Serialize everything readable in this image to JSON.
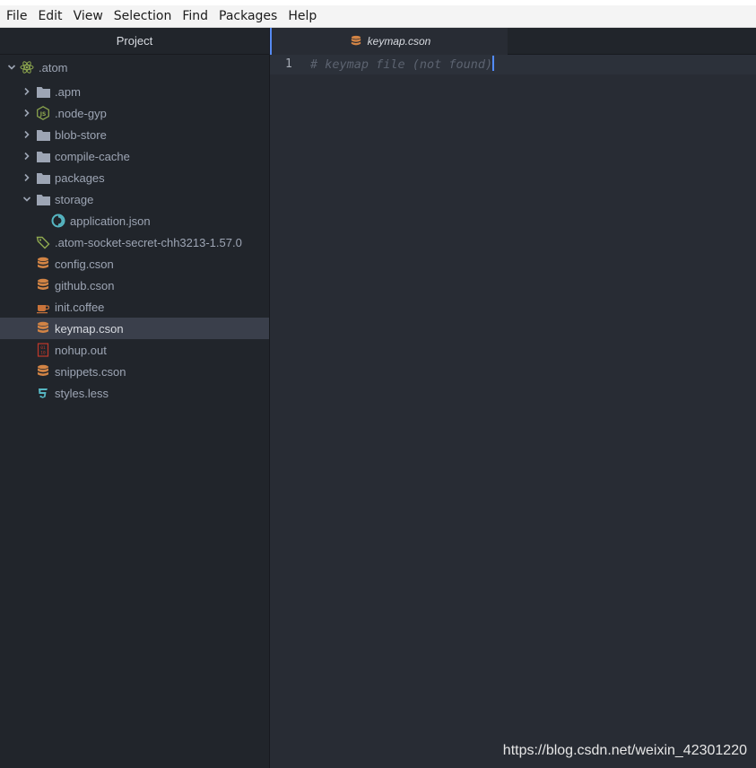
{
  "menubar": {
    "items": [
      "File",
      "Edit",
      "View",
      "Selection",
      "Find",
      "Packages",
      "Help"
    ]
  },
  "tree_view": {
    "header": "Project",
    "root": ".atom",
    "items": [
      {
        "label": ".apm",
        "icon": "folder-icon",
        "expanded": false
      },
      {
        "label": ".node-gyp",
        "icon": "nodejs-icon",
        "expanded": false
      },
      {
        "label": "blob-store",
        "icon": "folder-icon",
        "expanded": false
      },
      {
        "label": "compile-cache",
        "icon": "folder-icon",
        "expanded": false
      },
      {
        "label": "packages",
        "icon": "folder-icon",
        "expanded": false
      },
      {
        "label": "storage",
        "icon": "folder-icon",
        "expanded": true
      },
      {
        "label": "application.json",
        "icon": "json-icon"
      },
      {
        "label": ".atom-socket-secret-chh3213-1.57.0",
        "icon": "tag-icon"
      },
      {
        "label": "config.cson",
        "icon": "database-icon"
      },
      {
        "label": "github.cson",
        "icon": "database-icon"
      },
      {
        "label": "init.coffee",
        "icon": "coffee-icon"
      },
      {
        "label": "keymap.cson",
        "icon": "database-icon",
        "selected": true
      },
      {
        "label": "nohup.out",
        "icon": "binary-icon"
      },
      {
        "label": "snippets.cson",
        "icon": "database-icon"
      },
      {
        "label": "styles.less",
        "icon": "css-icon"
      }
    ]
  },
  "editor": {
    "tab_title": "keymap.cson",
    "line_number": "1",
    "code": "# keymap file (not found)"
  },
  "watermark": "https://blog.csdn.net/weixin_42301220",
  "colors": {
    "accent": "#568af2",
    "db_icon": "#d28445",
    "folder_icon": "#9da5b4",
    "node_icon": "#8fa94f"
  }
}
